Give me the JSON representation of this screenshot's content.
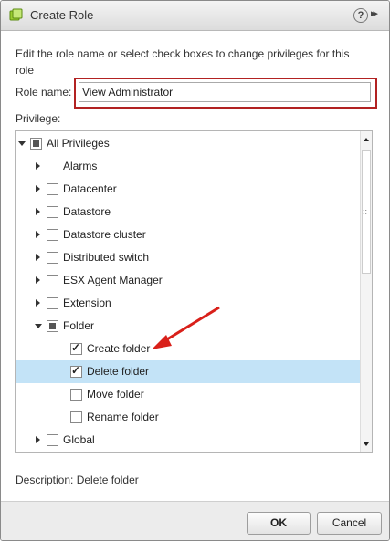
{
  "dialog": {
    "title": "Create Role",
    "help": "?",
    "expand": "▸▸"
  },
  "intro": "Edit the role name or select check boxes to change privileges for this role",
  "role_name": {
    "label": "Role name:",
    "value": "View Administrator"
  },
  "privilege_label": "Privilege:",
  "tree": {
    "items": [
      {
        "label": "All Privileges",
        "level": 0,
        "toggle": "expanded",
        "check": "partial"
      },
      {
        "label": "Alarms",
        "level": 1,
        "toggle": "collapsed",
        "check": "unchecked"
      },
      {
        "label": "Datacenter",
        "level": 1,
        "toggle": "collapsed",
        "check": "unchecked"
      },
      {
        "label": "Datastore",
        "level": 1,
        "toggle": "collapsed",
        "check": "unchecked"
      },
      {
        "label": "Datastore cluster",
        "level": 1,
        "toggle": "collapsed",
        "check": "unchecked"
      },
      {
        "label": "Distributed switch",
        "level": 1,
        "toggle": "collapsed",
        "check": "unchecked"
      },
      {
        "label": "ESX Agent Manager",
        "level": 1,
        "toggle": "collapsed",
        "check": "unchecked"
      },
      {
        "label": "Extension",
        "level": 1,
        "toggle": "collapsed",
        "check": "unchecked"
      },
      {
        "label": "Folder",
        "level": 1,
        "toggle": "expanded",
        "check": "partial"
      },
      {
        "label": "Create folder",
        "level": 2,
        "toggle": "none",
        "check": "checked"
      },
      {
        "label": "Delete folder",
        "level": 2,
        "toggle": "none",
        "check": "checked",
        "selected": true
      },
      {
        "label": "Move folder",
        "level": 2,
        "toggle": "none",
        "check": "unchecked"
      },
      {
        "label": "Rename folder",
        "level": 2,
        "toggle": "none",
        "check": "unchecked"
      },
      {
        "label": "Global",
        "level": 1,
        "toggle": "collapsed",
        "check": "unchecked"
      }
    ]
  },
  "description": {
    "label": "Description:",
    "value": "Delete folder"
  },
  "buttons": {
    "ok": "OK",
    "cancel": "Cancel"
  },
  "colors": {
    "selection": "#c3e3f7",
    "highlight_border": "#b22222",
    "annotation_arrow": "#d9201a"
  }
}
